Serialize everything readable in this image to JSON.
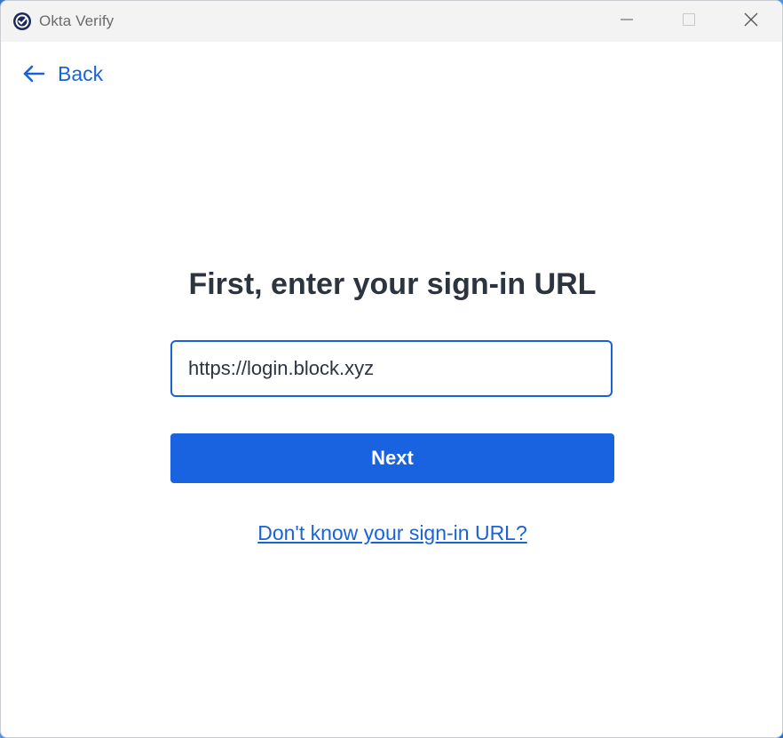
{
  "window": {
    "title": "Okta Verify"
  },
  "nav": {
    "back_label": "Back"
  },
  "main": {
    "heading": "First, enter your sign-in URL",
    "url_input_value": "https://login.block.xyz",
    "next_label": "Next",
    "help_link_label": "Don't know your sign-in URL?"
  },
  "icons": {
    "app": "okta-verify-logo-icon",
    "back": "arrow-left-icon",
    "minimize": "minimize-icon",
    "maximize": "maximize-icon",
    "close": "close-icon"
  },
  "colors": {
    "accent": "#1a63e0",
    "link": "#1a63d6",
    "heading": "#2c3440",
    "titlebar": "#f3f3f3"
  }
}
